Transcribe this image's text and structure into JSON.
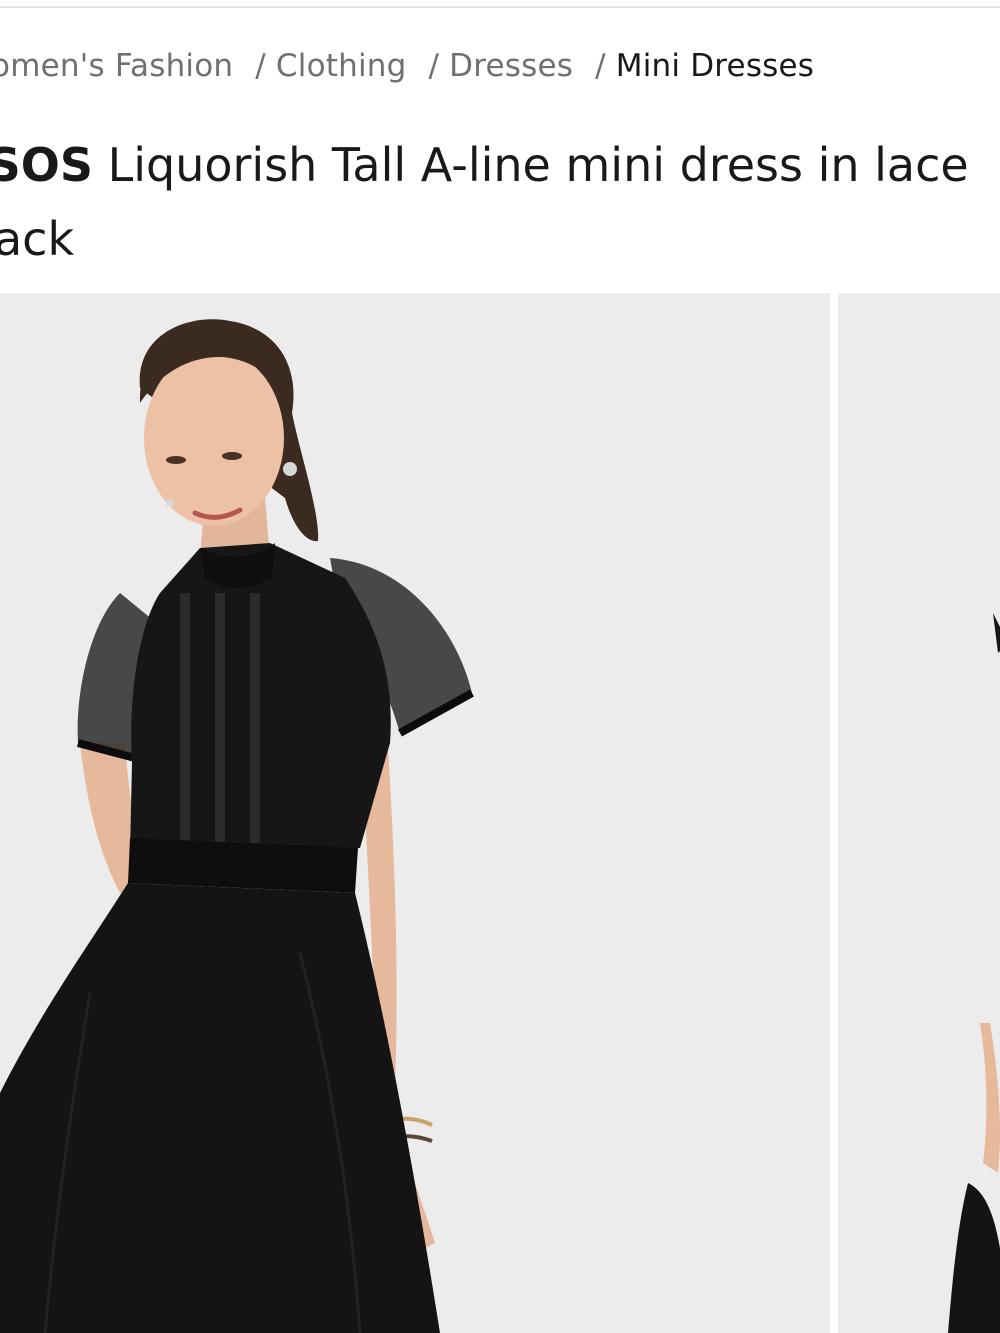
{
  "breadcrumb": {
    "items": [
      {
        "label": "Women's Fashion"
      },
      {
        "label": "Clothing"
      },
      {
        "label": "Dresses"
      },
      {
        "label": "Mini Dresses"
      }
    ],
    "separator": "/"
  },
  "product": {
    "brand": "ASOS",
    "title": "Liquorish Tall A-line mini dress in lace",
    "title_line2": "black"
  },
  "gallery": {
    "images": [
      {
        "alt": "Model wearing black A-line mini dress with lace sleeves"
      },
      {
        "alt": "Second product view"
      }
    ]
  },
  "colors": {
    "text": "#191919",
    "muted": "#707070",
    "photo_bg": "#ececec",
    "dress": "#141414"
  }
}
